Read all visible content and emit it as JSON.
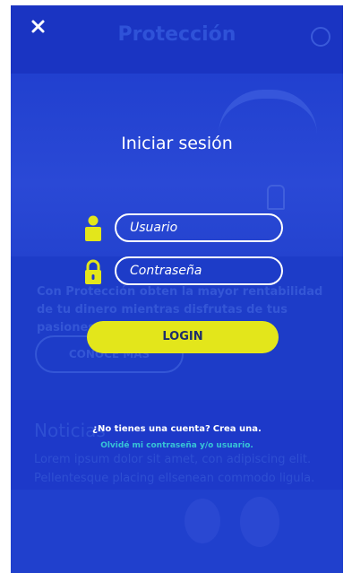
{
  "background_page": {
    "header_title": "Protección",
    "promo_text": "Con Protección obten la mayor rentabilidad de tu dinero mientras disfrutas de tus pasiones.",
    "promo_button": "CONOCE MÁS",
    "news_title": "Noticias",
    "news_body": "Lorem ipsum dolor sit amet, con adipiscing elit. Pellentesque placing ellsenean commodo ligula."
  },
  "login_modal": {
    "close_icon": "close-icon",
    "title": "Iniciar sesión",
    "username": {
      "placeholder": "Usuario",
      "icon": "user-icon"
    },
    "password": {
      "placeholder": "Contraseña",
      "icon": "lock-icon"
    },
    "login_label": "LOGIN",
    "signup_prompt": "¿No tienes una cuenta?",
    "signup_link": "Crea una.",
    "forgot_link": "Olvidé mi contraseña y/o usuario."
  },
  "colors": {
    "overlay_blue": "#1d39c9",
    "accent_yellow": "#e3e61b",
    "link_cyan": "#37c4d6",
    "text_white": "#ffffff"
  }
}
